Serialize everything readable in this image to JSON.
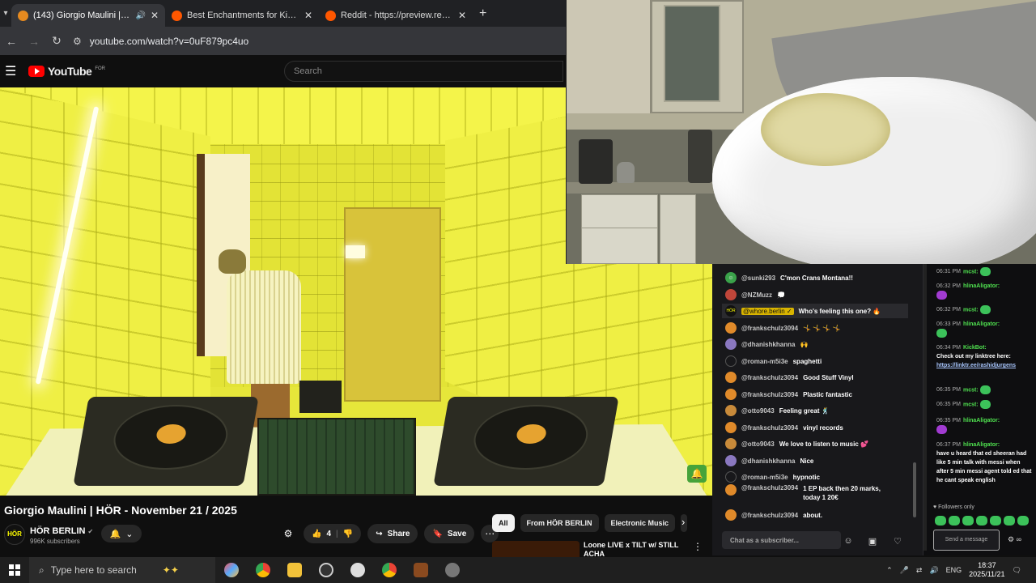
{
  "browser": {
    "tabs": [
      {
        "title": "(143) Giorgio Maulini | HÖR",
        "active": true
      },
      {
        "title": "Best Enchantments for King's Ec",
        "active": false
      },
      {
        "title": "Reddit - https://preview.redd.it",
        "active": false
      }
    ],
    "url": "youtube.com/watch?v=0uF879pc4uo"
  },
  "youtube": {
    "logo_word": "YouTube",
    "logo_country": "FOR",
    "search_placeholder": "Search",
    "video_title": "Giorgio Maulini | HÖR - November 21 / 2025",
    "channel": {
      "name": "HÖR BERLIN",
      "subs": "996K subscribers",
      "avatar_text": "HÖR"
    },
    "likes": "4",
    "share_label": "Share",
    "save_label": "Save",
    "chips": [
      {
        "label": "All",
        "selected": true
      },
      {
        "label": "From HÖR BERLIN",
        "selected": false
      },
      {
        "label": "Electronic Music",
        "selected": false
      }
    ],
    "recommendation": {
      "title": "Loone LIVE x TILT w/ STILL ACHA"
    }
  },
  "chat1": {
    "placeholder": "Chat as a subscriber...",
    "messages": [
      {
        "user": "@sunki293",
        "text": "C'mon Crans Montana!!",
        "av": "#3aa24a"
      },
      {
        "user": "@NZMuzz",
        "text": "💭",
        "av": "#c0463a"
      },
      {
        "user": "@whore.berlin ✓",
        "text": "Who's feeling this one? 🔥",
        "av": "#111111",
        "highlight": true
      },
      {
        "user": "@frankschulz3094",
        "text": "🤸 🤸 🤸 🤸",
        "av": "#e08a2a"
      },
      {
        "user": "@dhanishkhanna",
        "text": "🙌",
        "av": "#8a78c0"
      },
      {
        "user": "@roman-m5i3e",
        "text": "spaghetti",
        "av": "#18181b"
      },
      {
        "user": "@frankschulz3094",
        "text": "Good Stuff Vinyl",
        "av": "#e08a2a"
      },
      {
        "user": "@frankschulz3094",
        "text": "Plastic fantastic",
        "av": "#e08a2a"
      },
      {
        "user": "@otto9043",
        "text": "Feeling great 🕺",
        "av": "#c88a3a"
      },
      {
        "user": "@frankschulz3094",
        "text": "vinyl records",
        "av": "#e08a2a"
      },
      {
        "user": "@otto9043",
        "text": "We love to listen to music 💕",
        "av": "#c88a3a"
      },
      {
        "user": "@dhanishkhanna",
        "text": "Nice",
        "av": "#8a78c0"
      },
      {
        "user": "@roman-m5i3e",
        "text": "hypnotic",
        "av": "#18181b"
      },
      {
        "user": "@frankschulz3094",
        "text": "1 EP back then 20 marks, today 1 20€",
        "av": "#e08a2a"
      },
      {
        "user": "@frankschulz3094",
        "text": "about.",
        "av": "#e08a2a"
      }
    ]
  },
  "chat2": {
    "followers_only": "Followers only",
    "send_placeholder": "Send a message",
    "messages": [
      {
        "time": "06:31 PM",
        "user": "mcst:",
        "text": ""
      },
      {
        "time": "06:32 PM",
        "user": "hlinaAligator:",
        "text": ""
      },
      {
        "time": "06:32 PM",
        "user": "mcst:",
        "text": ""
      },
      {
        "time": "06:33 PM",
        "user": "hlinaAligator:",
        "text": ""
      },
      {
        "time": "06:34 PM",
        "user": "KickBot:",
        "text": "Check out my linktree here:",
        "link": "https://linktr.ee/rashidjurgens"
      },
      {
        "time": "06:35 PM",
        "user": "mcst:",
        "text": ""
      },
      {
        "time": "06:35 PM",
        "user": "mcst:",
        "text": ""
      },
      {
        "time": "06:35 PM",
        "user": "hlinaAligator:",
        "text": ""
      },
      {
        "time": "06:37 PM",
        "user": "hlinaAligator:",
        "text": "have u heard that ed sheeran had like 5 min talk with messi when after 5 min messi agent told ed that he cant speak english"
      }
    ]
  },
  "taskbar": {
    "search_placeholder": "Type here to search",
    "lang": "ENG",
    "time": "18:37",
    "date": "2025/11/21"
  }
}
